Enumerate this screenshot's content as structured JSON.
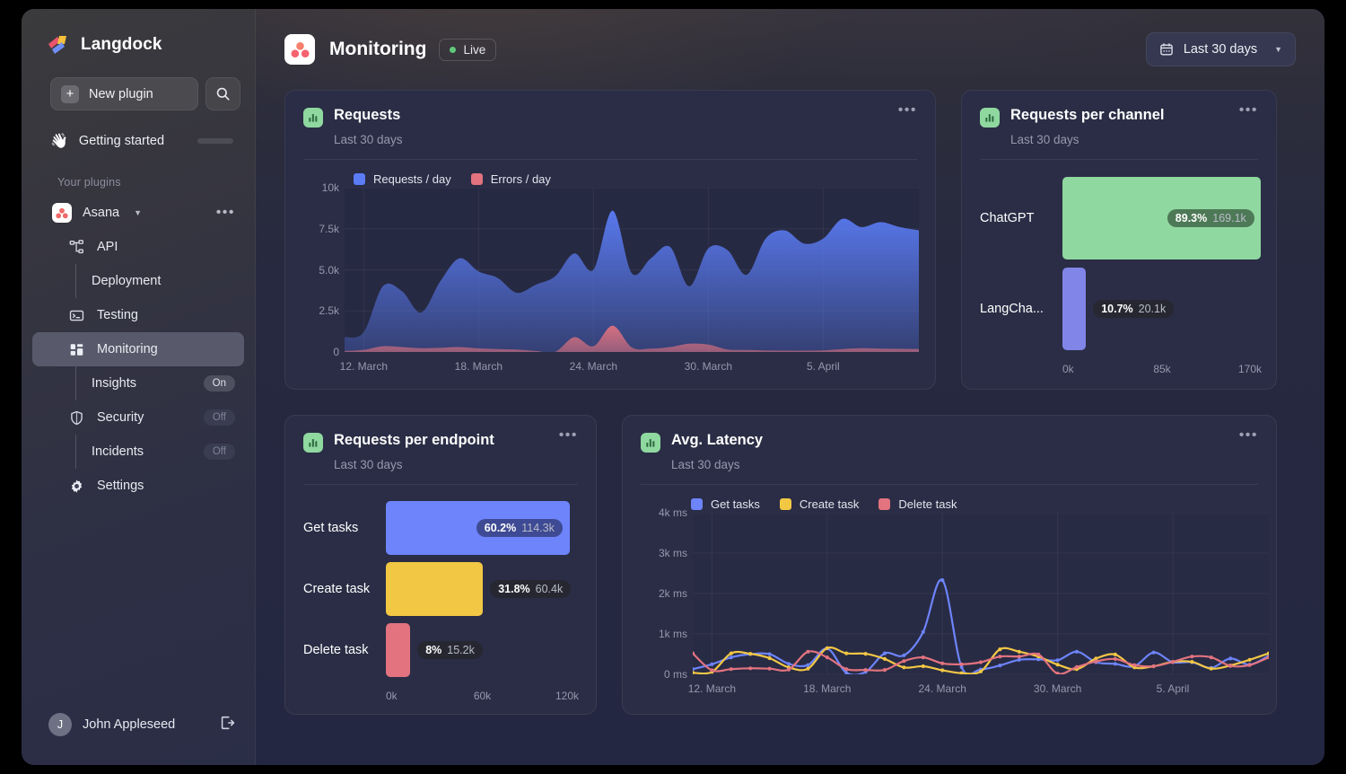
{
  "brand": {
    "name": "Langdock"
  },
  "sidebar": {
    "new_plugin_label": "New plugin",
    "search_icon": "search-icon",
    "getting_started": {
      "label": "Getting started",
      "icon": "waving-hand-icon",
      "progress": 33
    },
    "section_label": "Your plugins",
    "plugin": {
      "name": "Asana",
      "icon": "asana-icon",
      "menu_icon": "ellipsis-icon"
    },
    "items": [
      {
        "label": "API",
        "icon": "sitemap-icon",
        "level": 1,
        "active": false,
        "badge": null
      },
      {
        "label": "Deployment",
        "icon": null,
        "level": 2,
        "active": false,
        "badge": null
      },
      {
        "label": "Testing",
        "icon": "terminal-icon",
        "level": 1,
        "active": false,
        "badge": null
      },
      {
        "label": "Monitoring",
        "icon": "dashboard-icon",
        "level": 1,
        "active": true,
        "badge": null
      },
      {
        "label": "Insights",
        "icon": null,
        "level": 2,
        "active": false,
        "badge": "On"
      },
      {
        "label": "Security",
        "icon": "shield-icon",
        "level": 1,
        "active": false,
        "badge": "Off"
      },
      {
        "label": "Incidents",
        "icon": null,
        "level": 2,
        "active": false,
        "badge": "Off"
      },
      {
        "label": "Settings",
        "icon": "gear-icon",
        "level": 1,
        "active": false,
        "badge": null
      }
    ],
    "user": {
      "initial": "J",
      "name": "John Appleseed",
      "logout_icon": "logout-icon"
    }
  },
  "header": {
    "app_icon": "asana-icon",
    "title": "Monitoring",
    "status": "Live",
    "date_range": "Last 30 days",
    "calendar_icon": "calendar-icon",
    "chevron_icon": "chevron-down-icon"
  },
  "colors": {
    "requests_blue": "#5b7cf5",
    "errors_red": "#e2737f",
    "green": "#8fd8a0",
    "yellow": "#f2c744",
    "purple": "#8185e8",
    "accent_live": "#5fc97a"
  },
  "cards": {
    "requests": {
      "title": "Requests",
      "subtitle": "Last 30 days",
      "menu": "ellipsis-icon"
    },
    "channel": {
      "title": "Requests per channel",
      "subtitle": "Last 30 days",
      "menu": "ellipsis-icon"
    },
    "endpoint": {
      "title": "Requests per endpoint",
      "subtitle": "Last 30 days",
      "menu": "ellipsis-icon"
    },
    "latency": {
      "title": "Avg. Latency",
      "subtitle": "Last 30 days",
      "menu": "ellipsis-icon"
    }
  },
  "chart_data": [
    {
      "id": "requests",
      "type": "area",
      "title": "Requests",
      "subtitle": "Last 30 days",
      "xlabel": "",
      "ylabel": "",
      "ylim": [
        0,
        10000
      ],
      "yticks": [
        "0",
        "2.5k",
        "5.0k",
        "7.5k",
        "10k"
      ],
      "ytick_values": [
        0,
        2500,
        5000,
        7500,
        10000
      ],
      "xticks": [
        "12. March",
        "18. March",
        "24. March",
        "30. March",
        "5. April"
      ],
      "xtick_positions": [
        1,
        7,
        13,
        19,
        25
      ],
      "grid": true,
      "legend": [
        "Requests / day",
        "Errors / day"
      ],
      "legend_position": "top-left",
      "x": [
        0,
        1,
        2,
        3,
        4,
        5,
        6,
        7,
        8,
        9,
        10,
        11,
        12,
        13,
        14,
        15,
        16,
        17,
        18,
        19,
        20,
        21,
        22,
        23,
        24,
        25,
        26,
        27,
        28,
        29,
        30
      ],
      "series": [
        {
          "name": "Requests / day",
          "color": "#5b7cf5",
          "values": [
            900,
            1200,
            4000,
            3700,
            2400,
            4300,
            5700,
            4900,
            4500,
            3600,
            4100,
            4600,
            6000,
            5000,
            8600,
            4800,
            5700,
            6400,
            4000,
            6300,
            6200,
            4700,
            6900,
            7400,
            6600,
            6900,
            8100,
            7600,
            7900,
            7600,
            7400
          ]
        },
        {
          "name": "Errors / day",
          "color": "#e2737f",
          "values": [
            60,
            130,
            350,
            300,
            230,
            250,
            300,
            220,
            180,
            150,
            60,
            10,
            900,
            350,
            1600,
            280,
            200,
            300,
            500,
            450,
            150,
            120,
            90,
            80,
            80,
            100,
            180,
            230,
            200,
            190,
            180
          ]
        }
      ]
    },
    {
      "id": "requests_per_channel",
      "type": "bar",
      "orientation": "horizontal",
      "title": "Requests per channel",
      "subtitle": "Last 30 days",
      "categories": [
        "ChatGPT",
        "LangCha..."
      ],
      "values": [
        169100,
        20100
      ],
      "value_labels": [
        "169.1k",
        "20.1k"
      ],
      "percent_labels": [
        "89.3%",
        "10.7%"
      ],
      "colors": [
        "#8fd8a0",
        "#8185e8"
      ],
      "xticks": [
        "0k",
        "85k",
        "170k"
      ],
      "xlim": [
        0,
        170000
      ]
    },
    {
      "id": "requests_per_endpoint",
      "type": "bar",
      "orientation": "horizontal",
      "title": "Requests per endpoint",
      "subtitle": "Last 30 days",
      "categories": [
        "Get tasks",
        "Create task",
        "Delete task"
      ],
      "values": [
        114300,
        60400,
        15200
      ],
      "value_labels": [
        "114.3k",
        "60.4k",
        "15.2k"
      ],
      "percent_labels": [
        "60.2%",
        "31.8%",
        "8%"
      ],
      "colors": [
        "#6d84fb",
        "#f2c744",
        "#e2737f"
      ],
      "xticks": [
        "0k",
        "60k",
        "120k"
      ],
      "xlim": [
        0,
        120000
      ]
    },
    {
      "id": "avg_latency",
      "type": "line",
      "title": "Avg. Latency",
      "subtitle": "Last 30 days",
      "ylim": [
        0,
        4000
      ],
      "yticks": [
        "0 ms",
        "1k ms",
        "2k ms",
        "3k ms",
        "4k ms"
      ],
      "ytick_values": [
        0,
        1000,
        2000,
        3000,
        4000
      ],
      "xticks": [
        "12. March",
        "18. March",
        "24. March",
        "30. March",
        "5. April"
      ],
      "xtick_positions": [
        1,
        7,
        13,
        19,
        25
      ],
      "legend": [
        "Get tasks",
        "Create task",
        "Delete task"
      ],
      "legend_position": "top-left",
      "grid": true,
      "x": [
        0,
        1,
        2,
        3,
        4,
        5,
        6,
        7,
        8,
        9,
        10,
        11,
        12,
        13,
        14,
        15,
        16,
        17,
        18,
        19,
        20,
        21,
        22,
        23,
        24,
        25,
        26,
        27,
        28,
        29,
        30
      ],
      "series": [
        {
          "name": "Get tasks",
          "color": "#6d84fb",
          "values": [
            130,
            250,
            420,
            500,
            500,
            260,
            230,
            640,
            40,
            60,
            520,
            470,
            1050,
            2330,
            180,
            120,
            220,
            360,
            370,
            350,
            560,
            300,
            260,
            200,
            540,
            300,
            300,
            160,
            390,
            240,
            460
          ]
        },
        {
          "name": "Create task",
          "color": "#f2c744",
          "values": [
            40,
            60,
            520,
            510,
            400,
            170,
            140,
            650,
            520,
            510,
            380,
            170,
            200,
            100,
            30,
            70,
            620,
            560,
            440,
            240,
            130,
            390,
            490,
            170,
            200,
            310,
            310,
            140,
            220,
            360,
            520
          ]
        },
        {
          "name": "Delete task",
          "color": "#e2737f",
          "values": [
            520,
            100,
            130,
            150,
            140,
            120,
            560,
            420,
            130,
            110,
            110,
            330,
            420,
            270,
            250,
            300,
            440,
            440,
            490,
            20,
            180,
            320,
            380,
            230,
            200,
            310,
            440,
            420,
            210,
            230,
            420
          ]
        }
      ]
    }
  ]
}
